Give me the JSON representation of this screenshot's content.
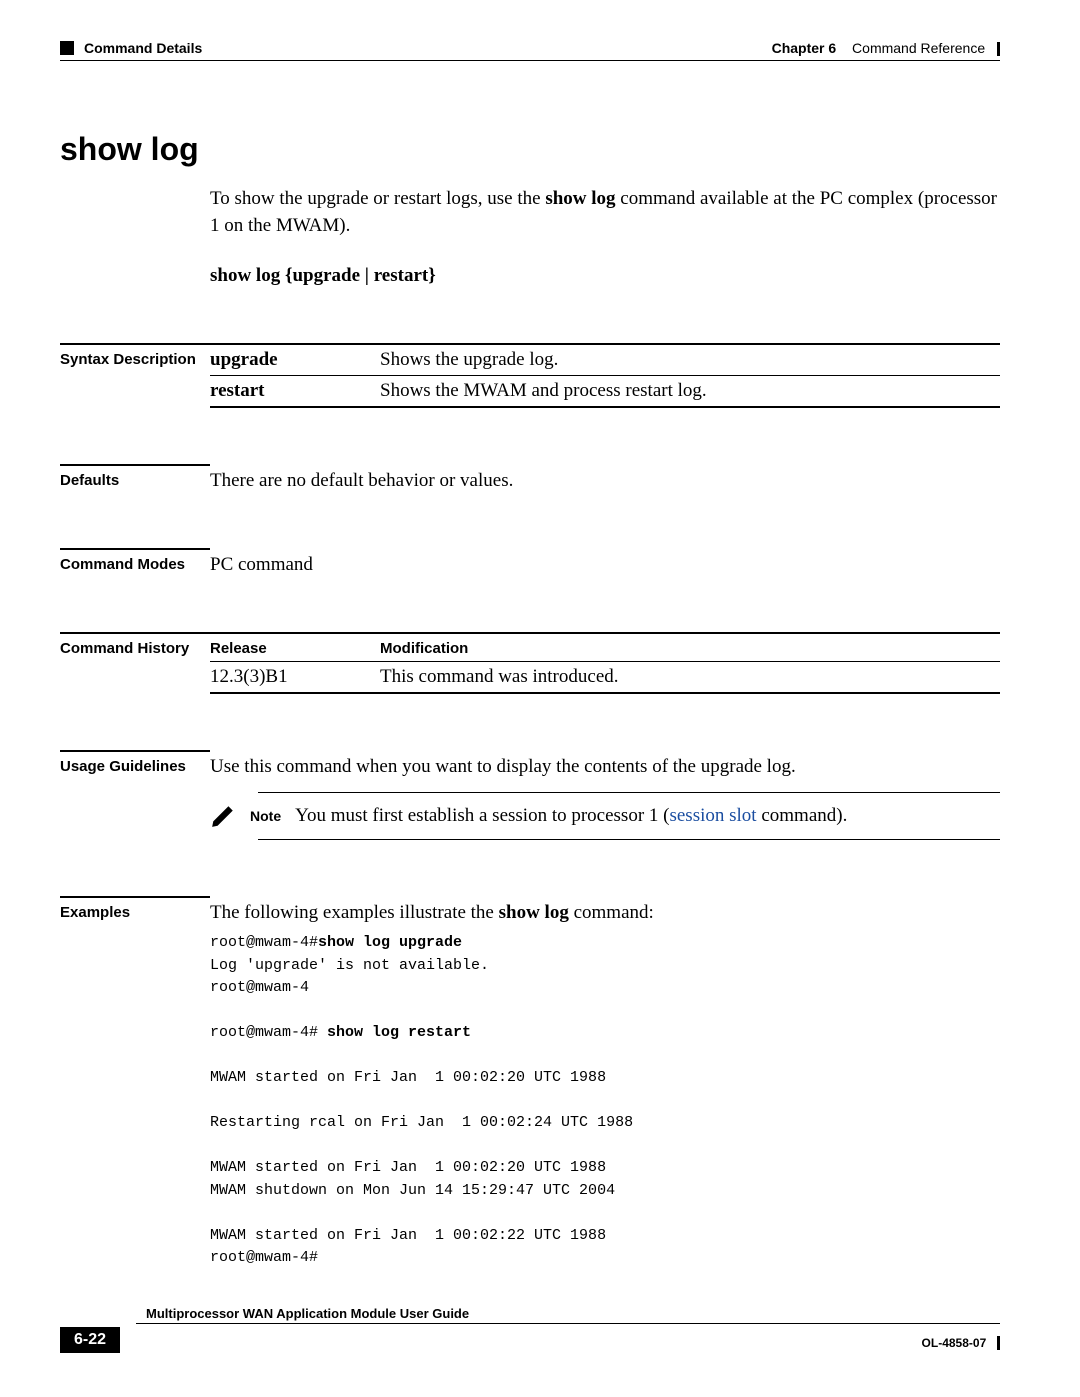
{
  "header": {
    "left_square": true,
    "left_text": "Command Details",
    "chapter": "Chapter 6",
    "chapter_title": "Command Reference"
  },
  "title": "show log",
  "intro_pre": "To show the upgrade or restart logs, use the ",
  "intro_bold": "show log",
  "intro_post": " command available at the PC complex (processor 1 on the MWAM).",
  "syntax_line": "show log {upgrade | restart}",
  "syntax": {
    "label": "Syntax Description",
    "rows": [
      {
        "kw": "upgrade",
        "desc": "Shows the upgrade log."
      },
      {
        "kw": "restart",
        "desc": "Shows the MWAM and process restart log."
      }
    ]
  },
  "defaults": {
    "label": "Defaults",
    "text": "There are no default behavior or values."
  },
  "modes": {
    "label": "Command Modes",
    "text": "PC command"
  },
  "history": {
    "label": "Command History",
    "head_rel": "Release",
    "head_mod": "Modification",
    "rows": [
      {
        "rel": "12.3(3)B1",
        "mod": "This command was introduced."
      }
    ]
  },
  "usage": {
    "label": "Usage Guidelines",
    "text": "Use this command when you want to display the contents of the upgrade log.",
    "note_label": "Note",
    "note_pre": "You must first establish a session to processor 1 (",
    "note_link": "session slot",
    "note_post": " command)."
  },
  "examples": {
    "label": "Examples",
    "intro_pre": "The following examples illustrate the ",
    "intro_bold": "show log",
    "intro_post": " command:",
    "code1_prompt": "root@mwam-4#",
    "code1_cmd": "show log upgrade",
    "code1_rest": "Log 'upgrade' is not available.\nroot@mwam-4",
    "code2_prompt": "root@mwam-4# ",
    "code2_cmd": "show log restart",
    "code2_rest": "\nMWAM started on Fri Jan  1 00:02:20 UTC 1988\n\nRestarting rcal on Fri Jan  1 00:02:24 UTC 1988\n\nMWAM started on Fri Jan  1 00:02:20 UTC 1988\nMWAM shutdown on Mon Jun 14 15:29:47 UTC 2004\n\nMWAM started on Fri Jan  1 00:02:22 UTC 1988\nroot@mwam-4#"
  },
  "footer": {
    "guide_title": "Multiprocessor WAN Application Module User Guide",
    "page": "6-22",
    "doc_id": "OL-4858-07"
  }
}
